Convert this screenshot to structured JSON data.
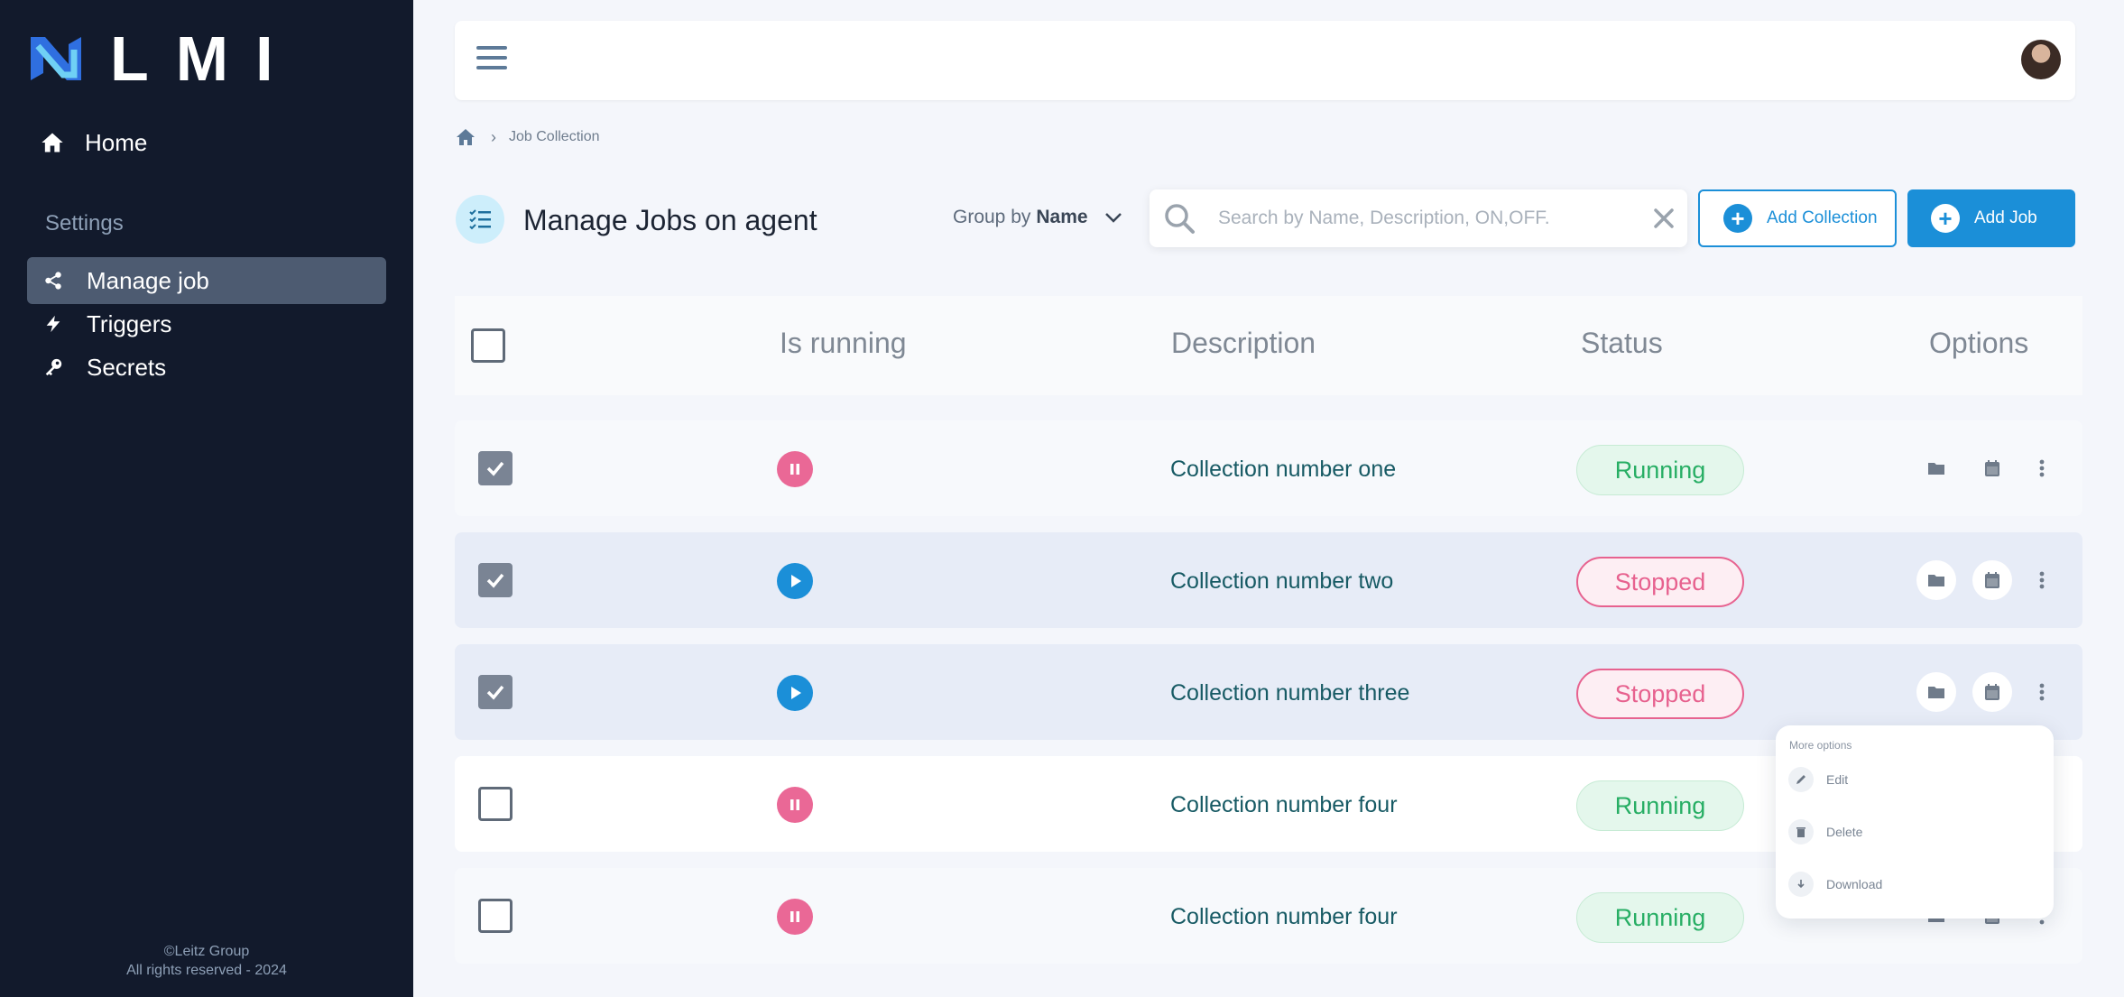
{
  "brand": {
    "name": "LMI"
  },
  "sidebar": {
    "home_label": "Home",
    "settings_label": "Settings",
    "items": [
      {
        "label": "Manage job",
        "icon": "share-nodes-icon",
        "active": true
      },
      {
        "label": "Triggers",
        "icon": "bolt-icon",
        "active": false
      },
      {
        "label": "Secrets",
        "icon": "key-icon",
        "active": false
      }
    ],
    "footer_line1": "©Leitz Group",
    "footer_line2": "All rights reserved - 2024"
  },
  "breadcrumb": {
    "current": "Job Collection"
  },
  "header": {
    "title": "Manage Jobs on agent",
    "group_by_label": "Group by",
    "group_by_value": "Name",
    "search_placeholder": "Search by Name, Description, ON,OFF.",
    "search_value": "",
    "add_collection_label": "Add Collection",
    "add_job_label": "Add Job"
  },
  "table": {
    "columns": [
      "Is running",
      "Description",
      "Status",
      "Options"
    ],
    "rows": [
      {
        "checked": true,
        "running": true,
        "description": "Collection number one",
        "status": "Running"
      },
      {
        "checked": true,
        "running": false,
        "description": "Collection number two",
        "status": "Stopped"
      },
      {
        "checked": true,
        "running": false,
        "description": "Collection number three",
        "status": "Stopped"
      },
      {
        "checked": false,
        "running": true,
        "description": "Collection number four",
        "status": "Running"
      },
      {
        "checked": false,
        "running": true,
        "description": "Collection number four",
        "status": "Running"
      }
    ]
  },
  "more_menu": {
    "title": "More options",
    "items": [
      "Edit",
      "Delete",
      "Download"
    ]
  },
  "colors": {
    "sidebar_bg": "#121a2c",
    "accent": "#1b8fd8",
    "running": "#27ae64",
    "stopped": "#e7628f"
  }
}
